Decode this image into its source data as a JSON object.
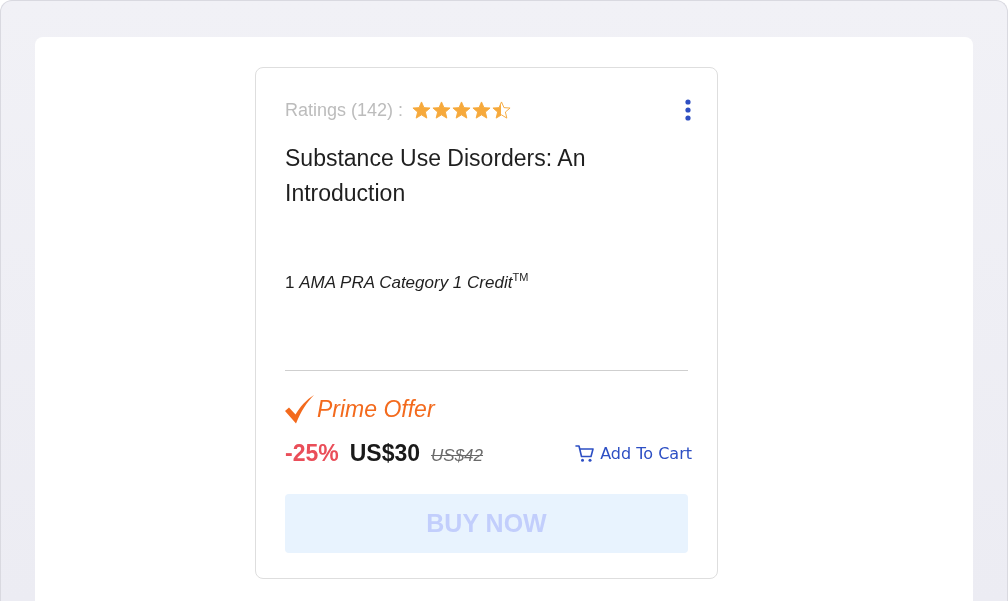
{
  "card": {
    "ratings": {
      "label": "Ratings (142) :",
      "stars": 4.5
    },
    "title": "Substance Use Disorders: An Introduction",
    "credit": "1 *AMA PRA Category 1 Credit*$^{TM}$",
    "offer": {
      "label": "Prime Offer"
    },
    "price": {
      "discount": "-25%",
      "current": "US$30",
      "original": "US$42"
    },
    "add_to_cart": "Add To Cart",
    "buy_button": {
      "label": "BUY NOW",
      "disabled": true
    }
  }
}
